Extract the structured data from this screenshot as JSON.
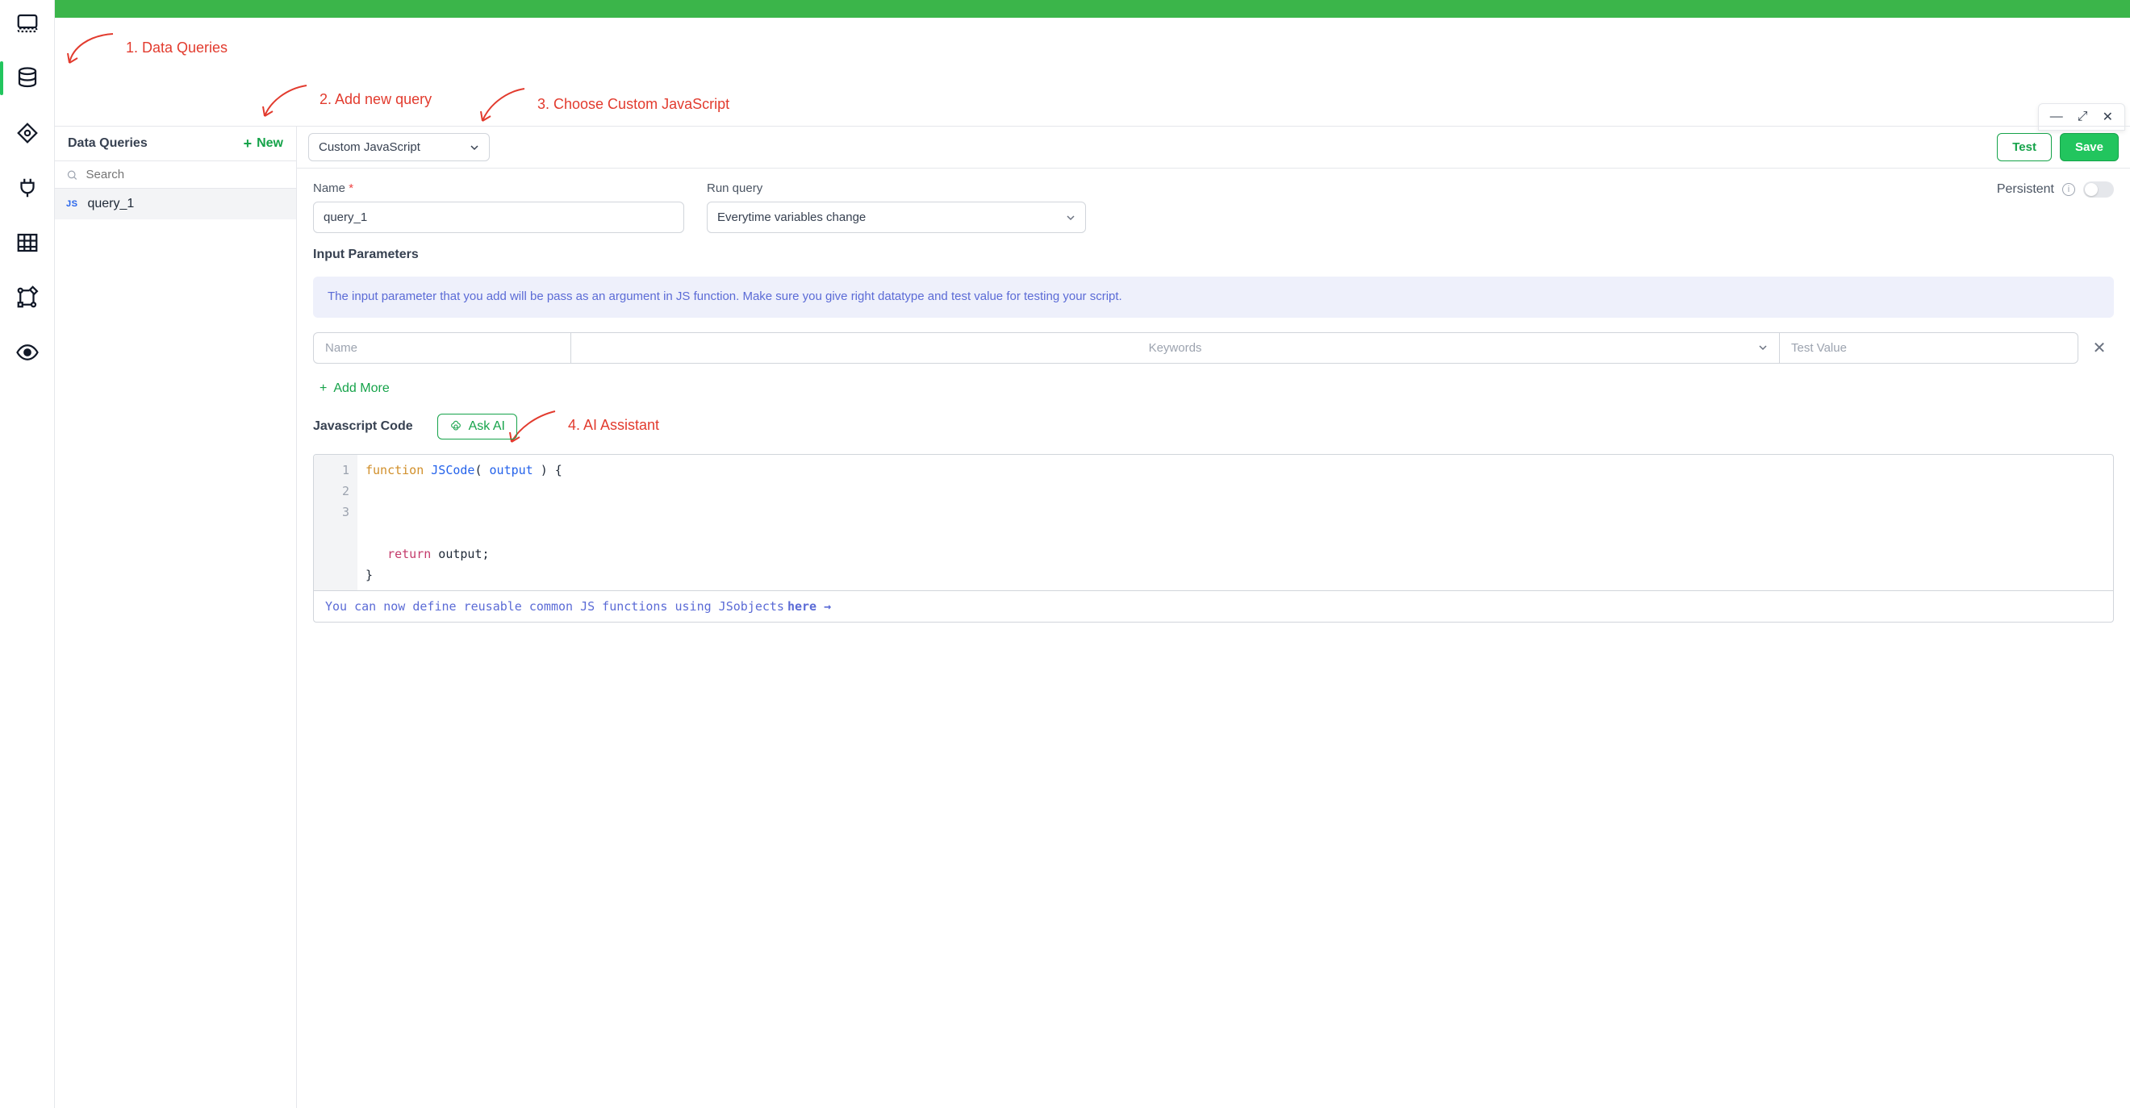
{
  "annotations": {
    "a1": "1. Data Queries",
    "a2": "2. Add new query",
    "a3": "3. Choose Custom JavaScript",
    "a4": "4. AI Assistant"
  },
  "rail": {
    "icons": [
      "ui-builder",
      "database",
      "eye-watch",
      "plug",
      "table",
      "workflow",
      "preview"
    ]
  },
  "querySidebar": {
    "title": "Data Queries",
    "newLabel": "New",
    "searchPlaceholder": "Search",
    "items": [
      {
        "badge": "JS",
        "name": "query_1"
      }
    ]
  },
  "toolbar": {
    "datasource": "Custom JavaScript",
    "testLabel": "Test",
    "saveLabel": "Save"
  },
  "form": {
    "nameLabel": "Name",
    "nameValue": "query_1",
    "runLabel": "Run query",
    "runValue": "Everytime variables change",
    "persistentLabel": "Persistent",
    "inputParamsTitle": "Input Parameters",
    "inputParamsNotice": "The input parameter that you add will be pass as an argument in JS function. Make sure you give right datatype and test value for testing your script.",
    "paramNamePlaceholder": "Name",
    "paramKeywordsPlaceholder": "Keywords",
    "paramTestValuePlaceholder": "Test Value",
    "addMoreLabel": "Add More",
    "jsCodeLabel": "Javascript Code",
    "askAiLabel": "Ask AI",
    "codeFooterPrefix": "You can now define reusable common JS functions using JSobjects ",
    "codeFooterLink": "here",
    "code": {
      "functionKeyword": "function",
      "functionName": "JSCode",
      "arg": "output",
      "openBrace": " ) {",
      "returnKeyword": "return",
      "returnExpr": " output;",
      "closeBrace": "}"
    }
  }
}
